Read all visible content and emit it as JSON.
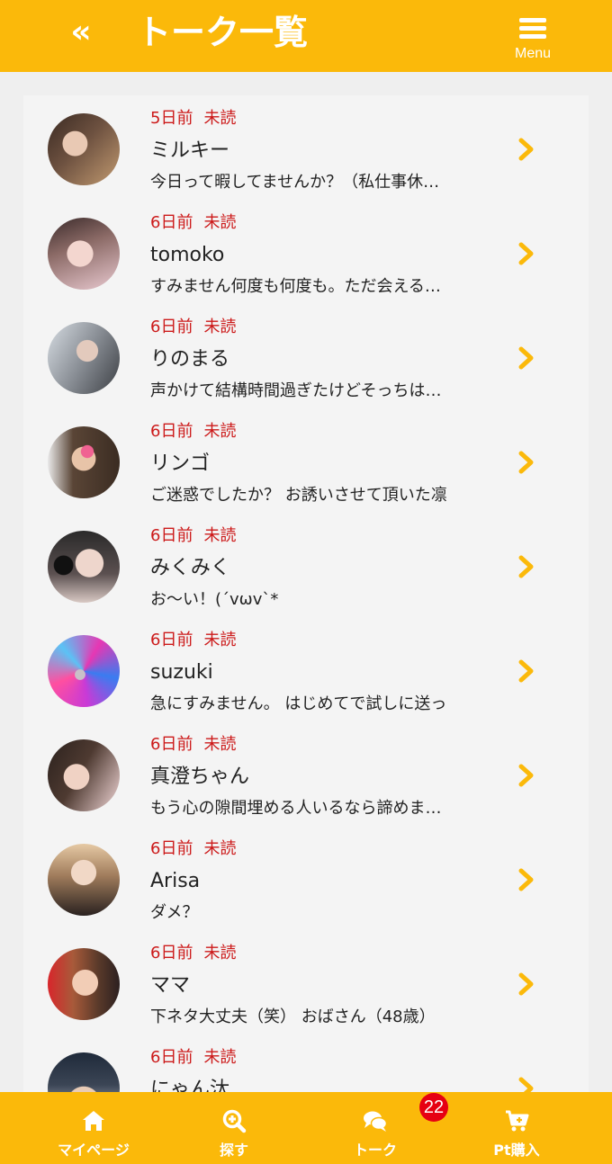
{
  "header": {
    "back_label": "«",
    "title": "トーク一覧",
    "menu_label": "Menu"
  },
  "colors": {
    "brand": "#fbb90a",
    "unread": "#cc1a1a",
    "badge": "#e60012"
  },
  "conversations": [
    {
      "time": "5日前",
      "status": "未読",
      "name": "ミルキー",
      "preview": "今日って暇してませんか？（私仕事休…"
    },
    {
      "time": "6日前",
      "status": "未読",
      "name": "tomoko",
      "preview": "すみません何度も何度も。ただ会える…"
    },
    {
      "time": "6日前",
      "status": "未読",
      "name": "りのまる",
      "preview": "声かけて結構時間過ぎたけどそっちは…"
    },
    {
      "time": "6日前",
      "status": "未読",
      "name": "リンゴ",
      "preview": "ご迷惑でしたか？ お誘いさせて頂いた凛"
    },
    {
      "time": "6日前",
      "status": "未読",
      "name": "みくみく",
      "preview": "お〜い！(´vωv`*"
    },
    {
      "time": "6日前",
      "status": "未読",
      "name": "suzuki",
      "preview": "急にすみません。 はじめてで試しに送っ"
    },
    {
      "time": "6日前",
      "status": "未読",
      "name": "真澄ちゃん",
      "preview": "もう心の隙間埋める人いるなら諦めま…"
    },
    {
      "time": "6日前",
      "status": "未読",
      "name": "Arisa",
      "preview": "ダメ？"
    },
    {
      "time": "6日前",
      "status": "未読",
      "name": "ママ",
      "preview": "下ネタ大丈夫（笑） おばさん（48歳）"
    },
    {
      "time": "6日前",
      "status": "未読",
      "name": "にゃん汰",
      "preview": ""
    }
  ],
  "bottom_nav": {
    "mypage_label": "マイページ",
    "search_label": "探す",
    "talk_label": "トーク",
    "talk_badge": "22",
    "points_label": "Pt購入"
  }
}
